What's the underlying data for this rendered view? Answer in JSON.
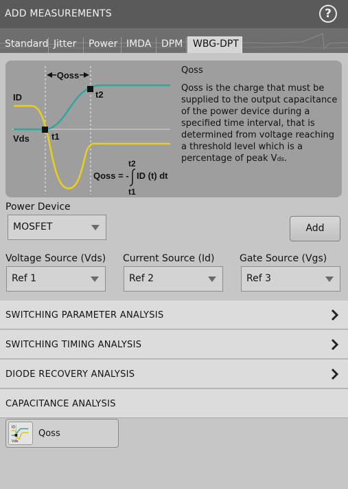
{
  "window": {
    "title": "ADD MEASUREMENTS",
    "help_label": "?"
  },
  "tabs": [
    "Standard",
    "Jitter",
    "Power",
    "IMDA",
    "DPM",
    "WBG-DPT"
  ],
  "active_tab": "WBG-DPT",
  "info": {
    "title": "Qoss",
    "description": "Qoss is the charge that must be supplied to the output capacitance of the power device during a specified time interval, that is determined from voltage reaching a threshold level which is a percentage of peak V",
    "description_subscript": "ds",
    "description_end": ".",
    "diagram": {
      "span_label": "Qoss",
      "id_label": "ID",
      "vds_label": "Vds",
      "t1_label": "t1",
      "t2_label": "t2",
      "formula_lhs": "Qoss = -",
      "formula_upper": "t2",
      "formula_lower": "t1",
      "formula_rhs": "ID (t) dt",
      "colors": {
        "id_trace": "#2aa9a0",
        "vds_trace": "#e8d01a"
      }
    }
  },
  "power_device": {
    "label": "Power Device",
    "value": "MOSFET"
  },
  "add_button": "Add",
  "sources": [
    {
      "label": "Voltage Source (Vds)",
      "value": "Ref 1"
    },
    {
      "label": "Current Source (Id)",
      "value": "Ref 2"
    },
    {
      "label": "Gate Source (Vgs)",
      "value": "Ref 3"
    }
  ],
  "sections": [
    {
      "label": "SWITCHING PARAMETER ANALYSIS",
      "expandable": true
    },
    {
      "label": "SWITCHING TIMING ANALYSIS",
      "expandable": true
    },
    {
      "label": "DIODE RECOVERY ANALYSIS",
      "expandable": true
    },
    {
      "label": "CAPACITANCE ANALYSIS",
      "expandable": false
    }
  ],
  "measurements": [
    {
      "label": "Qoss",
      "icon": "qoss-waveform-icon"
    }
  ]
}
